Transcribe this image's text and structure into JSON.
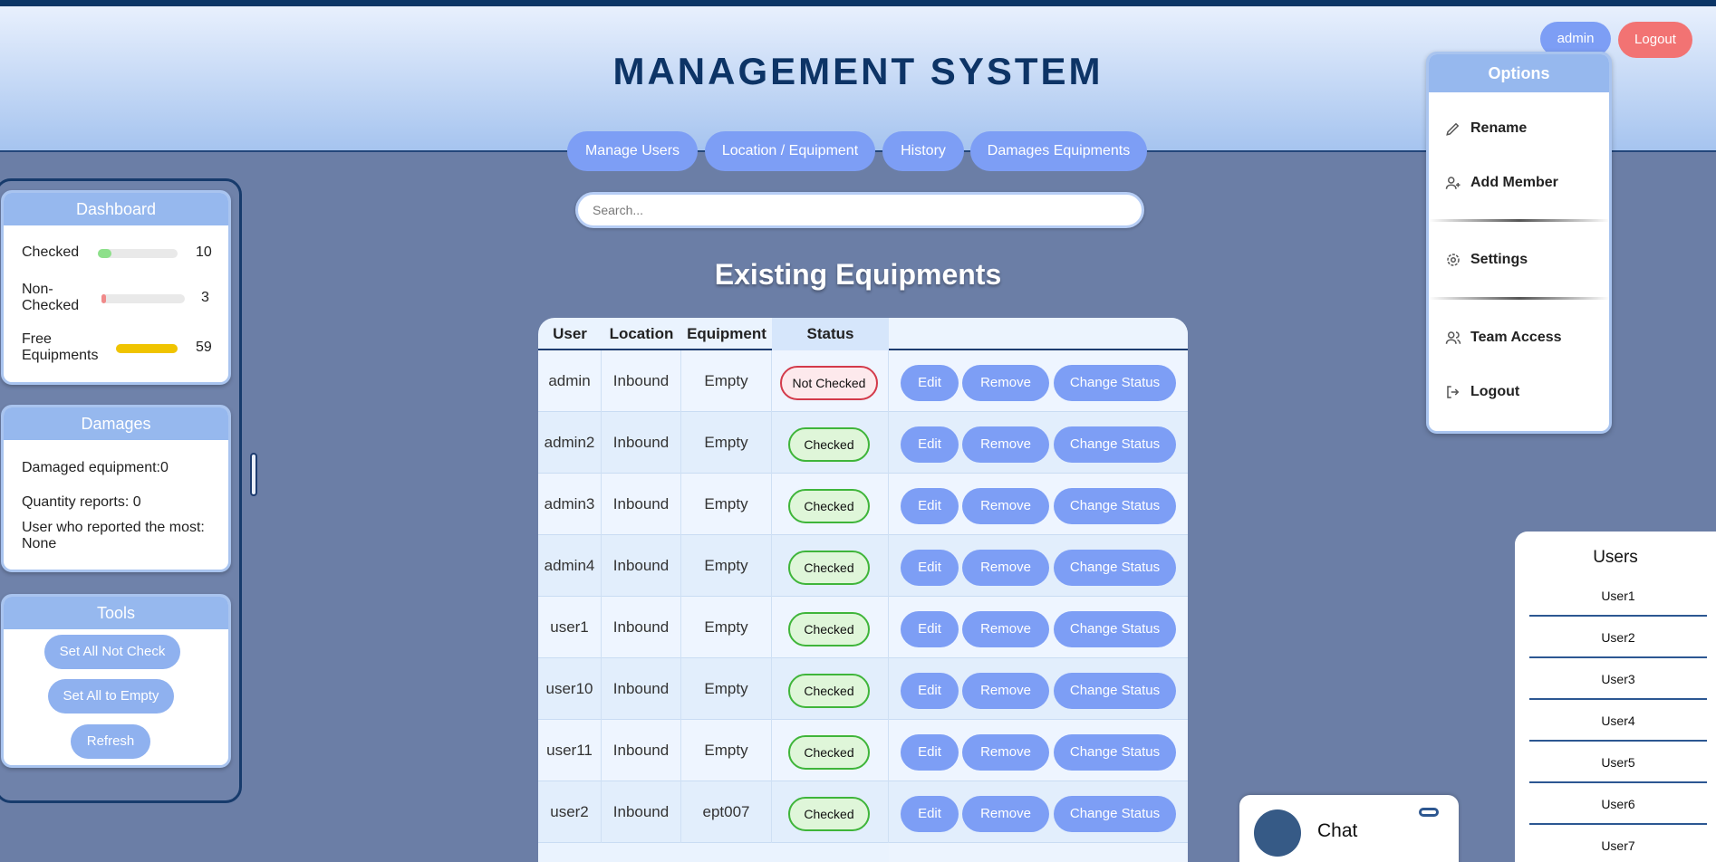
{
  "header": {
    "title": "MANAGEMENT SYSTEM",
    "user_button": "admin",
    "logout_button": "Logout"
  },
  "nav": [
    "Manage Users",
    "Location / Equipment",
    "History",
    "Damages Equipments"
  ],
  "search": {
    "placeholder": "Search..."
  },
  "main": {
    "heading": "Existing Equipments",
    "columns": [
      "User",
      "Location",
      "Equipment",
      "Status"
    ],
    "action_labels": {
      "edit": "Edit",
      "remove": "Remove",
      "change": "Change Status"
    },
    "rows": [
      {
        "user": "admin",
        "location": "Inbound",
        "equipment": "Empty",
        "status": "Not Checked"
      },
      {
        "user": "admin2",
        "location": "Inbound",
        "equipment": "Empty",
        "status": "Checked"
      },
      {
        "user": "admin3",
        "location": "Inbound",
        "equipment": "Empty",
        "status": "Checked"
      },
      {
        "user": "admin4",
        "location": "Inbound",
        "equipment": "Empty",
        "status": "Checked"
      },
      {
        "user": "user1",
        "location": "Inbound",
        "equipment": "Empty",
        "status": "Checked"
      },
      {
        "user": "user10",
        "location": "Inbound",
        "equipment": "Empty",
        "status": "Checked"
      },
      {
        "user": "user11",
        "location": "Inbound",
        "equipment": "Empty",
        "status": "Checked"
      },
      {
        "user": "user2",
        "location": "Inbound",
        "equipment": "ept007",
        "status": "Checked"
      }
    ]
  },
  "dashboard": {
    "title": "Dashboard",
    "checked_label": "Checked",
    "checked_value": "10",
    "checked_level": 0.17,
    "nonchecked_label_1": "Non-",
    "nonchecked_label_2": "Checked",
    "nonchecked_value": "3",
    "nonchecked_level": 0.05,
    "free_label_1": "Free",
    "free_label_2": "Equipments",
    "free_value": "59",
    "free_level": 1.0,
    "colors": {
      "checked": "#8de08a",
      "nonchecked": "#f08a8a",
      "free": "#f0c400"
    }
  },
  "damages": {
    "title": "Damages",
    "damaged": "Damaged equipment:0",
    "quantity": "Quantity reports: 0",
    "most_label": "User who reported the most:",
    "most_value": "None"
  },
  "tools": {
    "title": "Tools",
    "buttons": [
      "Set All Not Check",
      "Set All to Empty",
      "Refresh"
    ]
  },
  "options": {
    "title": "Options",
    "items": [
      "Rename",
      "Add Member",
      "Settings",
      "Team Access",
      "Logout"
    ]
  },
  "users_panel": {
    "title": "Users",
    "items": [
      "User1",
      "User2",
      "User3",
      "User4",
      "User5",
      "User6",
      "User7"
    ]
  },
  "chat": {
    "label": "Chat"
  }
}
